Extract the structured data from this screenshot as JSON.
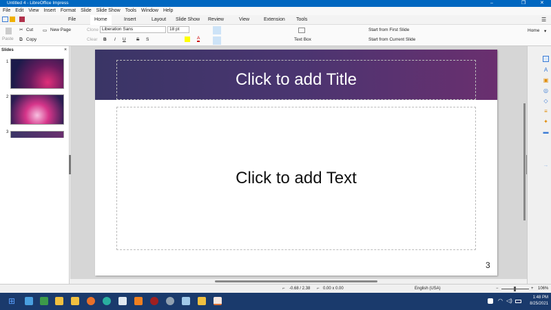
{
  "window": {
    "title": "Untitled 4 - LibreOffice Impress",
    "minimize": "–",
    "maximize": "❐",
    "close": "✕"
  },
  "menu": [
    "File",
    "Edit",
    "View",
    "Insert",
    "Format",
    "Slide",
    "Slide Show",
    "Tools",
    "Window",
    "Help"
  ],
  "tabs": [
    "File",
    "Home",
    "Insert",
    "Layout",
    "Slide Show",
    "Review",
    "View",
    "Extension",
    "Tools"
  ],
  "active_tab": "Home",
  "toolbar": {
    "paste": "Paste",
    "cut": "Cut",
    "copy": "Copy",
    "new_page": "New Page",
    "clone": "Clone",
    "clear": "Clear",
    "font_name": "Liberation Sans",
    "font_size": "18 pt",
    "bold": "B",
    "italic": "I",
    "underline": "U",
    "strike": "S",
    "shadow": "S",
    "text_box": "Text Box",
    "start_first": "Start from First Slide",
    "start_current": "Start from Current Slide",
    "home_dropdown": "Home"
  },
  "slides_pane": {
    "title": "Slides",
    "close": "×",
    "slides": [
      "1",
      "2",
      "3"
    ]
  },
  "slide": {
    "title_placeholder": "Click to add Title",
    "text_placeholder": "Click to add Text",
    "page_number": "3"
  },
  "status": {
    "position": "-0.68 / 2.38",
    "size": "0.00 x 0.00",
    "language": "English (USA)",
    "zoom": "106%",
    "zoom_level": 106
  },
  "taskbar": {
    "time": "1:48 PM",
    "date": "8/25/2021"
  },
  "colors": {
    "accent": "#0067c0",
    "taskbar": "#1a3a6c",
    "slide_header": "#4a3570"
  }
}
